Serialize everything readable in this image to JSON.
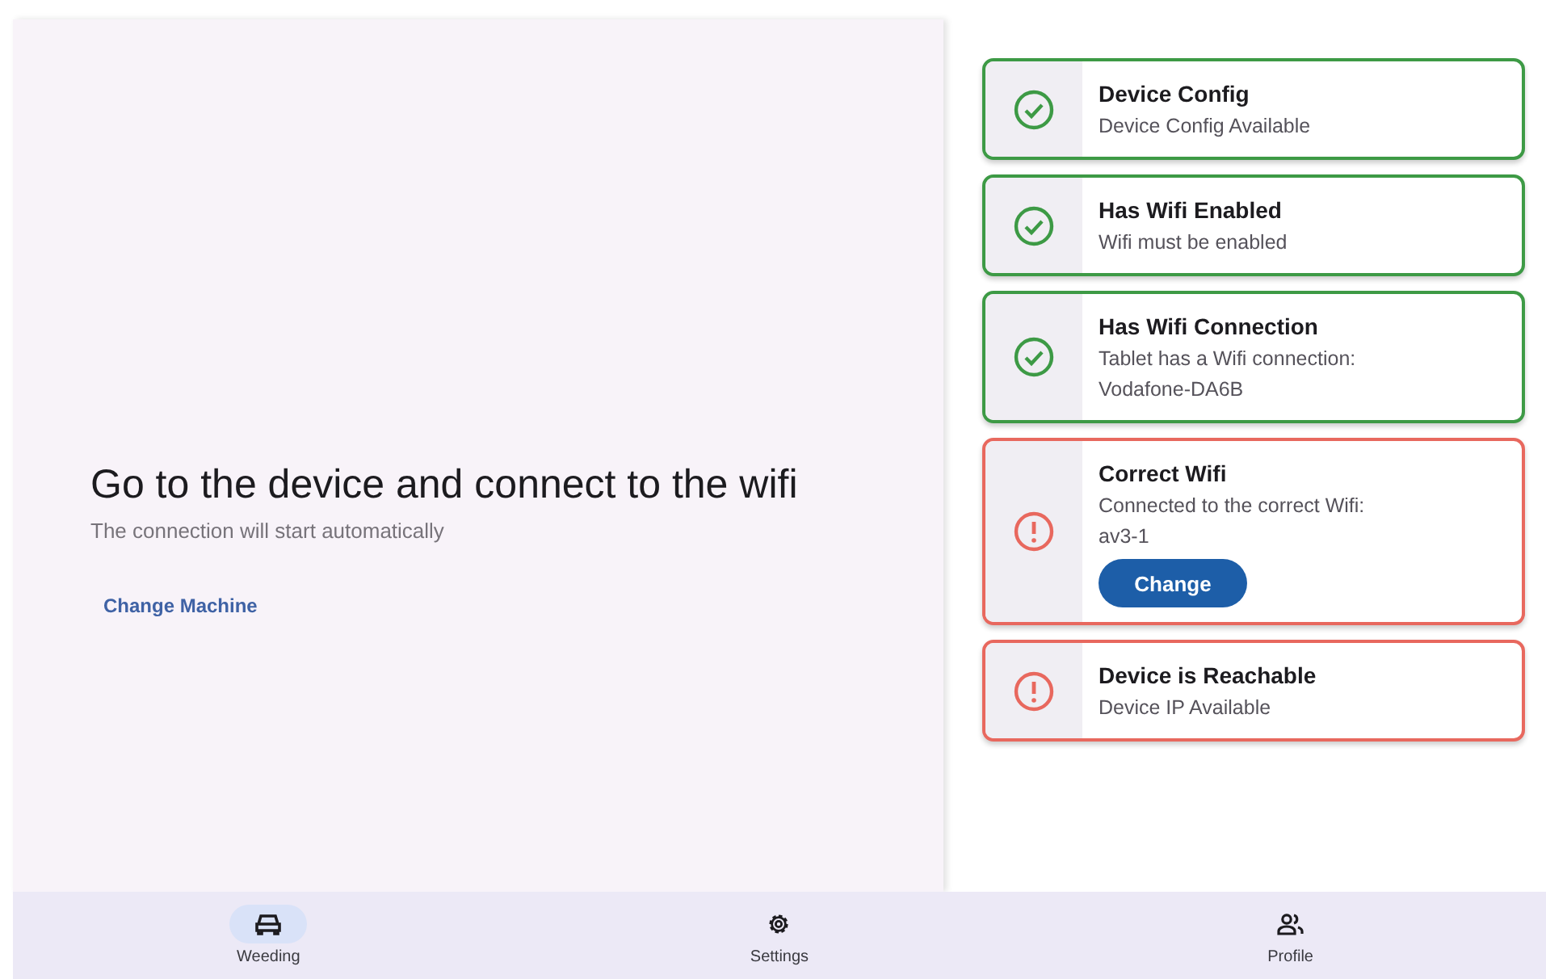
{
  "main": {
    "heading": "Go to the device and connect to the wifi",
    "subtitle": "The connection will start automatically",
    "link": "Change Machine"
  },
  "checks": [
    {
      "passed": true,
      "title": "Device Config",
      "lines": [
        "Device Config Available"
      ]
    },
    {
      "passed": true,
      "title": "Has Wifi Enabled",
      "lines": [
        "Wifi must be enabled"
      ]
    },
    {
      "passed": true,
      "title": "Has Wifi Connection",
      "lines": [
        "Tablet has a Wifi connection:",
        "Vodafone-DA6B"
      ]
    },
    {
      "passed": false,
      "title": "Correct Wifi",
      "lines": [
        "Connected to the correct Wifi:",
        "av3-1"
      ],
      "button": "Change"
    },
    {
      "passed": false,
      "title": "Device is Reachable",
      "lines": [
        "Device IP Available"
      ]
    }
  ],
  "nav": [
    {
      "kind": "car",
      "label": "Weeding",
      "selected": true
    },
    {
      "kind": "gear",
      "label": "Settings",
      "selected": false
    },
    {
      "kind": "people",
      "label": "Profile",
      "selected": false
    }
  ]
}
